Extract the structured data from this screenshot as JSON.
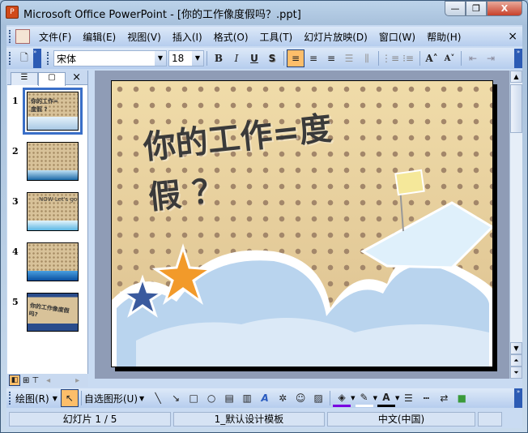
{
  "window": {
    "title": "Microsoft Office PowerPoint - [你的工作像度假吗？.ppt]",
    "minimize": "—",
    "restore": "❐",
    "close": "X"
  },
  "menu": [
    "文件(F)",
    "编辑(E)",
    "视图(V)",
    "插入(I)",
    "格式(O)",
    "工具(T)",
    "幻灯片放映(D)",
    "窗口(W)",
    "帮助(H)"
  ],
  "menu_close": "×",
  "format": {
    "font": "宋体",
    "size": "18",
    "bold": "B",
    "italic": "I",
    "underline": "U",
    "shadow": "S"
  },
  "pane": {
    "close": "×"
  },
  "thumbnails": [
    {
      "num": "1",
      "text": "你的工作=度假 ?"
    },
    {
      "num": "2",
      "text": ""
    },
    {
      "num": "3",
      "text": "NOW  Let's go"
    },
    {
      "num": "4",
      "text": ""
    },
    {
      "num": "5",
      "text": "你的工作像度假吗?"
    }
  ],
  "slide": {
    "title_line1": "你的工作=度",
    "title_line2": "假  ？"
  },
  "drawing": {
    "draw": "绘图(R)",
    "autoshapes": "自选图形(U)"
  },
  "status": {
    "slide": "幻灯片 1 / 5",
    "template": "1_默认设计模板",
    "language": "中文(中国)"
  },
  "colors": {
    "accent": "#fdbe6a",
    "selection": "#3a6fc8",
    "fill": "#7a00e0",
    "font": "#000000"
  }
}
